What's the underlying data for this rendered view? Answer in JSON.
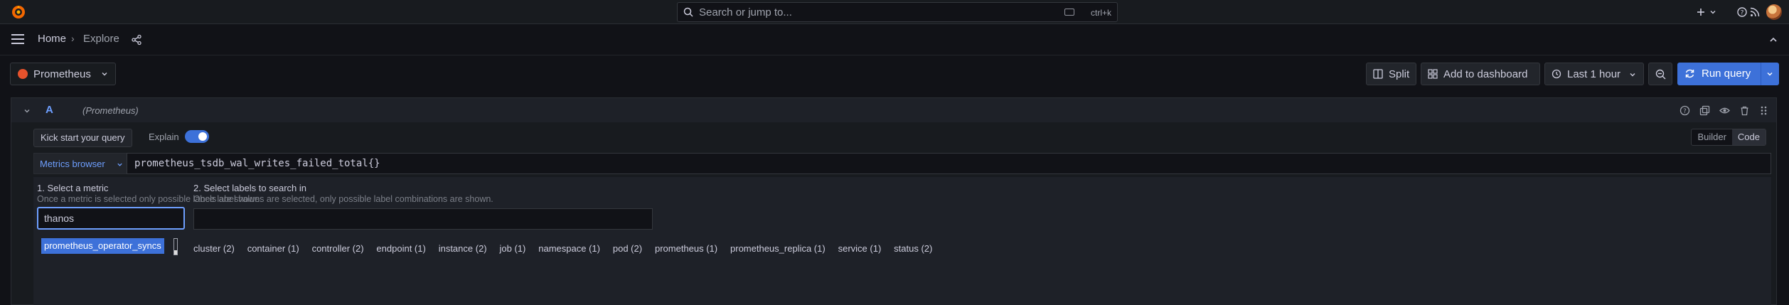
{
  "topbar": {
    "search_placeholder": "Search or jump to...",
    "search_shortcut": "ctrl+k"
  },
  "breadcrumb": {
    "home": "Home",
    "separator": "›",
    "current": "Explore"
  },
  "toolbar": {
    "datasource": "Prometheus",
    "split": "Split",
    "add_to_dashboard": "Add to dashboard",
    "time_range": "Last 1 hour",
    "run_query": "Run query"
  },
  "query": {
    "ref_id": "A",
    "datasource_name": "(Prometheus)",
    "kick_start": "Kick start your query",
    "explain_label": "Explain",
    "explain_enabled": true,
    "modes": [
      "Builder",
      "Code"
    ],
    "active_mode": "Code",
    "metrics_browser": "Metrics browser",
    "expression": "prometheus_tsdb_wal_writes_failed_total{}"
  },
  "browser": {
    "step1_title": "1. Select a metric",
    "step1_hint": "Once a metric is selected only possible labels are shown.",
    "metric_search": "thanos",
    "metric_results": [
      "prometheus_operator_syncs"
    ],
    "step2_title": "2. Select labels to search in",
    "step2_hint": "Once label values are selected, only possible label combinations are shown.",
    "labels": [
      "cluster (2)",
      "container (1)",
      "controller (2)",
      "endpoint (1)",
      "instance (2)",
      "job (1)",
      "namespace (1)",
      "pod (2)",
      "prometheus (1)",
      "prometheus_replica (1)",
      "service (1)",
      "status (2)"
    ]
  },
  "colors": {
    "accent": "#3d71d9",
    "link": "#6e9fff",
    "background": "#111217",
    "panel": "#181b1f"
  }
}
